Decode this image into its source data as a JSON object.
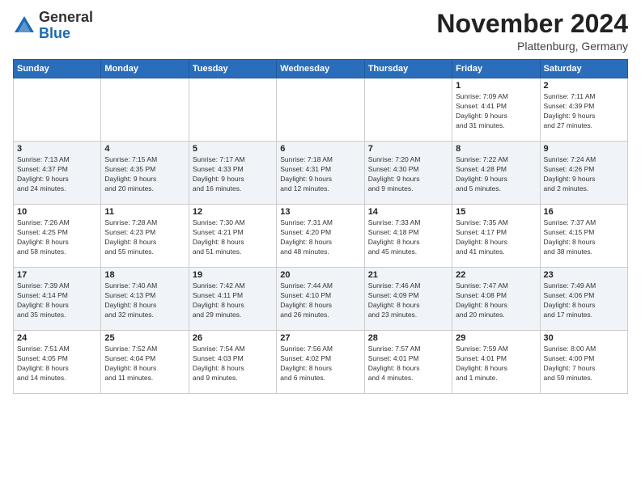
{
  "header": {
    "logo_general": "General",
    "logo_blue": "Blue",
    "month_title": "November 2024",
    "location": "Plattenburg, Germany"
  },
  "days_of_week": [
    "Sunday",
    "Monday",
    "Tuesday",
    "Wednesday",
    "Thursday",
    "Friday",
    "Saturday"
  ],
  "weeks": [
    [
      {
        "day": "",
        "info": ""
      },
      {
        "day": "",
        "info": ""
      },
      {
        "day": "",
        "info": ""
      },
      {
        "day": "",
        "info": ""
      },
      {
        "day": "",
        "info": ""
      },
      {
        "day": "1",
        "info": "Sunrise: 7:09 AM\nSunset: 4:41 PM\nDaylight: 9 hours\nand 31 minutes."
      },
      {
        "day": "2",
        "info": "Sunrise: 7:11 AM\nSunset: 4:39 PM\nDaylight: 9 hours\nand 27 minutes."
      }
    ],
    [
      {
        "day": "3",
        "info": "Sunrise: 7:13 AM\nSunset: 4:37 PM\nDaylight: 9 hours\nand 24 minutes."
      },
      {
        "day": "4",
        "info": "Sunrise: 7:15 AM\nSunset: 4:35 PM\nDaylight: 9 hours\nand 20 minutes."
      },
      {
        "day": "5",
        "info": "Sunrise: 7:17 AM\nSunset: 4:33 PM\nDaylight: 9 hours\nand 16 minutes."
      },
      {
        "day": "6",
        "info": "Sunrise: 7:18 AM\nSunset: 4:31 PM\nDaylight: 9 hours\nand 12 minutes."
      },
      {
        "day": "7",
        "info": "Sunrise: 7:20 AM\nSunset: 4:30 PM\nDaylight: 9 hours\nand 9 minutes."
      },
      {
        "day": "8",
        "info": "Sunrise: 7:22 AM\nSunset: 4:28 PM\nDaylight: 9 hours\nand 5 minutes."
      },
      {
        "day": "9",
        "info": "Sunrise: 7:24 AM\nSunset: 4:26 PM\nDaylight: 9 hours\nand 2 minutes."
      }
    ],
    [
      {
        "day": "10",
        "info": "Sunrise: 7:26 AM\nSunset: 4:25 PM\nDaylight: 8 hours\nand 58 minutes."
      },
      {
        "day": "11",
        "info": "Sunrise: 7:28 AM\nSunset: 4:23 PM\nDaylight: 8 hours\nand 55 minutes."
      },
      {
        "day": "12",
        "info": "Sunrise: 7:30 AM\nSunset: 4:21 PM\nDaylight: 8 hours\nand 51 minutes."
      },
      {
        "day": "13",
        "info": "Sunrise: 7:31 AM\nSunset: 4:20 PM\nDaylight: 8 hours\nand 48 minutes."
      },
      {
        "day": "14",
        "info": "Sunrise: 7:33 AM\nSunset: 4:18 PM\nDaylight: 8 hours\nand 45 minutes."
      },
      {
        "day": "15",
        "info": "Sunrise: 7:35 AM\nSunset: 4:17 PM\nDaylight: 8 hours\nand 41 minutes."
      },
      {
        "day": "16",
        "info": "Sunrise: 7:37 AM\nSunset: 4:15 PM\nDaylight: 8 hours\nand 38 minutes."
      }
    ],
    [
      {
        "day": "17",
        "info": "Sunrise: 7:39 AM\nSunset: 4:14 PM\nDaylight: 8 hours\nand 35 minutes."
      },
      {
        "day": "18",
        "info": "Sunrise: 7:40 AM\nSunset: 4:13 PM\nDaylight: 8 hours\nand 32 minutes."
      },
      {
        "day": "19",
        "info": "Sunrise: 7:42 AM\nSunset: 4:11 PM\nDaylight: 8 hours\nand 29 minutes."
      },
      {
        "day": "20",
        "info": "Sunrise: 7:44 AM\nSunset: 4:10 PM\nDaylight: 8 hours\nand 26 minutes."
      },
      {
        "day": "21",
        "info": "Sunrise: 7:46 AM\nSunset: 4:09 PM\nDaylight: 8 hours\nand 23 minutes."
      },
      {
        "day": "22",
        "info": "Sunrise: 7:47 AM\nSunset: 4:08 PM\nDaylight: 8 hours\nand 20 minutes."
      },
      {
        "day": "23",
        "info": "Sunrise: 7:49 AM\nSunset: 4:06 PM\nDaylight: 8 hours\nand 17 minutes."
      }
    ],
    [
      {
        "day": "24",
        "info": "Sunrise: 7:51 AM\nSunset: 4:05 PM\nDaylight: 8 hours\nand 14 minutes."
      },
      {
        "day": "25",
        "info": "Sunrise: 7:52 AM\nSunset: 4:04 PM\nDaylight: 8 hours\nand 11 minutes."
      },
      {
        "day": "26",
        "info": "Sunrise: 7:54 AM\nSunset: 4:03 PM\nDaylight: 8 hours\nand 9 minutes."
      },
      {
        "day": "27",
        "info": "Sunrise: 7:56 AM\nSunset: 4:02 PM\nDaylight: 8 hours\nand 6 minutes."
      },
      {
        "day": "28",
        "info": "Sunrise: 7:57 AM\nSunset: 4:01 PM\nDaylight: 8 hours\nand 4 minutes."
      },
      {
        "day": "29",
        "info": "Sunrise: 7:59 AM\nSunset: 4:01 PM\nDaylight: 8 hours\nand 1 minute."
      },
      {
        "day": "30",
        "info": "Sunrise: 8:00 AM\nSunset: 4:00 PM\nDaylight: 7 hours\nand 59 minutes."
      }
    ]
  ]
}
